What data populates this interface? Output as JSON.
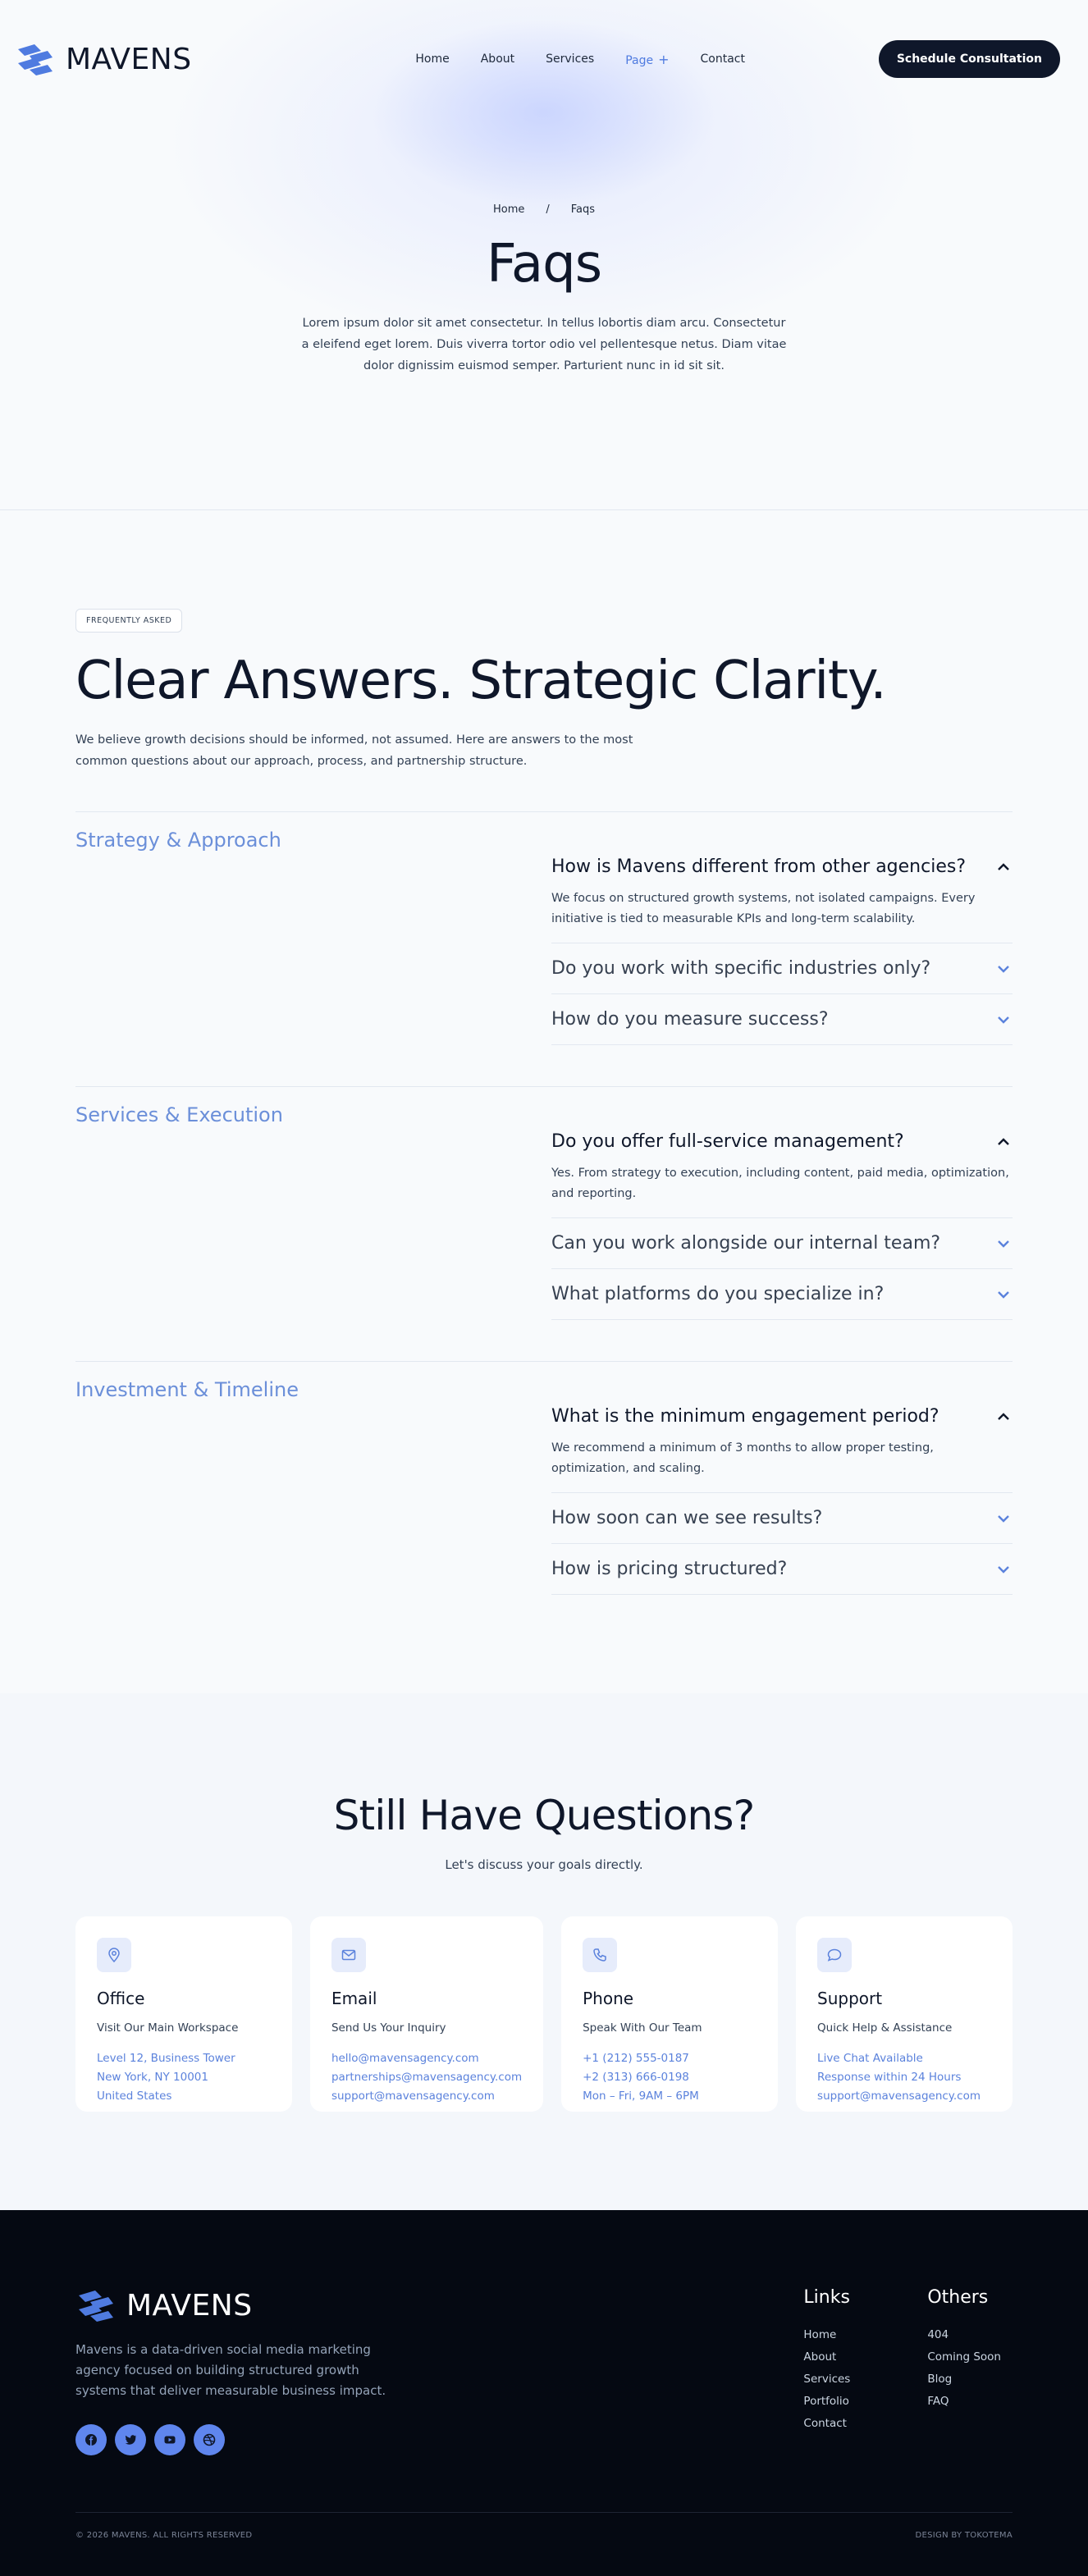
{
  "brand": {
    "name": "MAVENS",
    "accent": "#4f7be0",
    "dark": "#0f172a"
  },
  "nav": {
    "items": [
      {
        "label": "Home"
      },
      {
        "label": "About"
      },
      {
        "label": "Services"
      },
      {
        "label": "Page"
      },
      {
        "label": "Contact"
      }
    ],
    "cta": "Schedule Consultation"
  },
  "hero": {
    "breadcrumb": [
      "Home",
      "/",
      "Faqs"
    ],
    "title": "Faqs",
    "text": "Lorem ipsum dolor sit amet consectetur. In tellus lobortis diam arcu. Consectetur a eleifend eget lorem. Duis viverra tortor odio vel pellentesque netus. Diam vitae dolor dignissim euismod semper. Parturient nunc in id sit sit."
  },
  "faq": {
    "badge": "FREQUENTLY ASKED",
    "title": "Clear Answers. Strategic Clarity.",
    "intro": "We believe growth decisions should be informed, not assumed. Here are answers to the most common questions about our approach, process, and partnership structure.",
    "groups": [
      {
        "label": "Strategy & Approach",
        "items": [
          {
            "q": "How is Mavens different from other agencies?",
            "a": "We focus on structured growth systems, not isolated campaigns. Every initiative is tied to measurable KPIs and long-term scalability."
          },
          {
            "q": "Do you work with specific industries only?"
          },
          {
            "q": "How do you measure success?"
          }
        ]
      },
      {
        "label": "Services & Execution",
        "items": [
          {
            "q": "Do you offer full-service management?",
            "a": "Yes. From strategy to execution, including content, paid media, optimization, and reporting."
          },
          {
            "q": "Can you work alongside our internal team?"
          },
          {
            "q": "What platforms do you specialize in?"
          }
        ]
      },
      {
        "label": "Investment & Timeline",
        "items": [
          {
            "q": "What is the minimum engagement period?",
            "a": "We recommend a minimum of 3 months to allow proper testing, optimization, and scaling."
          },
          {
            "q": "How soon can we see results?"
          },
          {
            "q": "How is pricing structured?"
          }
        ]
      }
    ]
  },
  "contact": {
    "title": "Still Have Questions?",
    "subtitle": "Let's discuss your goals directly.",
    "cards": [
      {
        "icon": "map-pin-icon",
        "title": "Office",
        "sub": "Visit Our Main Workspace",
        "lines": [
          "Level 12, Business Tower",
          "New York, NY 10001",
          "United States"
        ]
      },
      {
        "icon": "mail-icon",
        "title": "Email",
        "sub": "Send Us Your Inquiry",
        "lines": [
          "hello@mavensagency.com",
          "partnerships@mavensagency.com",
          "support@mavensagency.com"
        ]
      },
      {
        "icon": "phone-icon",
        "title": "Phone",
        "sub": "Speak With Our Team",
        "lines": [
          "+1 (212) 555-0187",
          "+2 (313) 666-0198",
          "Mon – Fri, 9AM – 6PM"
        ]
      },
      {
        "icon": "chat-icon",
        "title": "Support",
        "sub": "Quick Help & Assistance",
        "lines": [
          "Live Chat Available",
          "Response within 24 Hours",
          "support@mavensagency.com"
        ]
      }
    ]
  },
  "footer": {
    "description": "Mavens is a data-driven social media marketing agency focused on building structured growth systems that deliver measurable business impact.",
    "socials": [
      "facebook-icon",
      "twitter-icon",
      "youtube-icon",
      "dribbble-icon"
    ],
    "columns": [
      {
        "title": "Links",
        "items": [
          "Home",
          "About",
          "Services",
          "Portfolio",
          "Contact"
        ]
      },
      {
        "title": "Others",
        "items": [
          "404",
          "Coming Soon",
          "Blog",
          "FAQ"
        ]
      }
    ],
    "copyright": "© 2026 MAVENS. ALL RIGHTS RESERVED",
    "credit": "DESIGN BY TOKOTEMA"
  }
}
